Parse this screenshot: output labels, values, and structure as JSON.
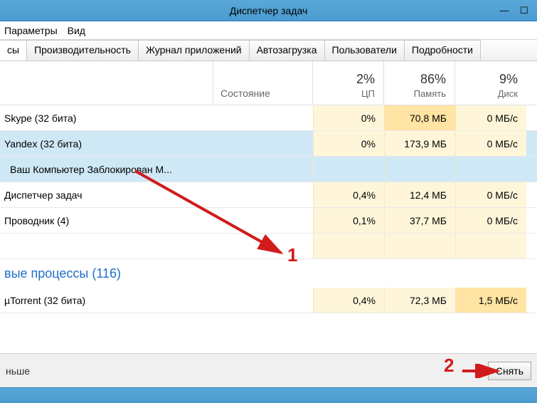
{
  "window": {
    "title": "Диспетчер задач",
    "min": "—",
    "max": "☐"
  },
  "menu": {
    "params": "Параметры",
    "view": "Вид"
  },
  "tabs": {
    "t0": "сы",
    "t1": "Производительность",
    "t2": "Журнал приложений",
    "t3": "Автозагрузка",
    "t4": "Пользователи",
    "t5": "Подробности"
  },
  "headers": {
    "status": "Состояние",
    "cpu_pct": "2%",
    "cpu_lbl": "ЦП",
    "mem_pct": "86%",
    "mem_lbl": "Память",
    "disk_pct": "9%",
    "disk_lbl": "Диск"
  },
  "rows": [
    {
      "name": "Skype (32 бита)",
      "cpu": "0%",
      "mem": "70,8 МБ",
      "disk": "0 МБ/с",
      "sel": false,
      "cpu_cls": "tint-y",
      "mem_cls": "tint-o",
      "disk_cls": "tint-y"
    },
    {
      "name": "Yandex (32 бита)",
      "cpu": "0%",
      "mem": "173,9 МБ",
      "disk": "0 МБ/с",
      "sel": true,
      "cpu_cls": "tint-y",
      "mem_cls": "tint-y",
      "disk_cls": "tint-y"
    },
    {
      "name": "Ваш Компьютер Заблокирован М...",
      "child": true
    },
    {
      "name": "Диспетчер задач",
      "cpu": "0,4%",
      "mem": "12,4 МБ",
      "disk": "0 МБ/с",
      "sel": false,
      "cpu_cls": "tint-y",
      "mem_cls": "tint-y",
      "disk_cls": "tint-y"
    },
    {
      "name": "Проводник (4)",
      "cpu": "0,1%",
      "mem": "37,7 МБ",
      "disk": "0 МБ/с",
      "sel": false,
      "cpu_cls": "tint-y",
      "mem_cls": "tint-y",
      "disk_cls": "tint-y"
    }
  ],
  "group": {
    "label": "вые процессы (116)"
  },
  "rows2": [
    {
      "name": "µTorrent (32 бита)",
      "cpu": "0,4%",
      "mem": "72,3 МБ",
      "disk": "1,5 МБ/с",
      "cpu_cls": "tint-y",
      "mem_cls": "tint-y",
      "disk_cls": "tint-o"
    }
  ],
  "footer": {
    "less": "ньше",
    "end": "Снять"
  },
  "annot": {
    "n1": "1",
    "n2": "2"
  }
}
